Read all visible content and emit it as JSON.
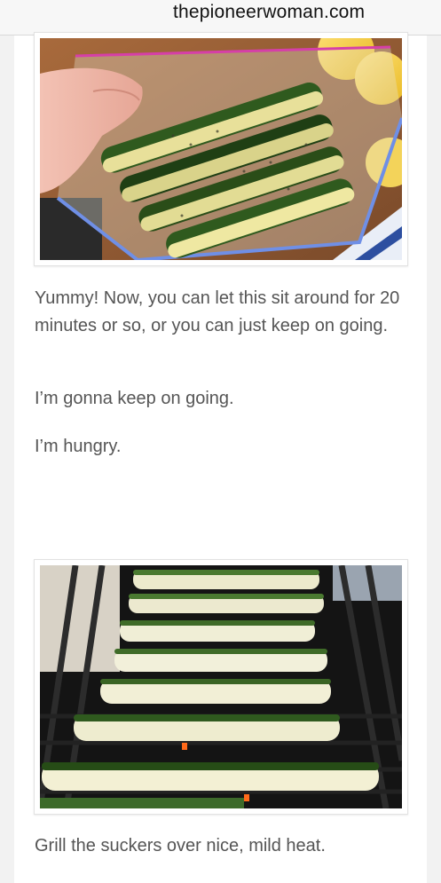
{
  "browser": {
    "url": "thepioneerwoman.com"
  },
  "article": {
    "paragraphs": [
      "Yummy! Now, you can let this sit around for 20 minutes or so, or you can just keep on going.",
      "I’m gonna keep on going.",
      "I’m hungry."
    ],
    "caption": "Grill the suckers over nice, mild heat."
  },
  "images": {
    "bag_photo_icon": "zucchini-in-bag-photo",
    "grill_photo_icon": "zucchini-on-grill-photo"
  },
  "colors": {
    "text": "#555555",
    "page_bg": "#ffffff",
    "outer_bg": "#f2f2f2"
  }
}
